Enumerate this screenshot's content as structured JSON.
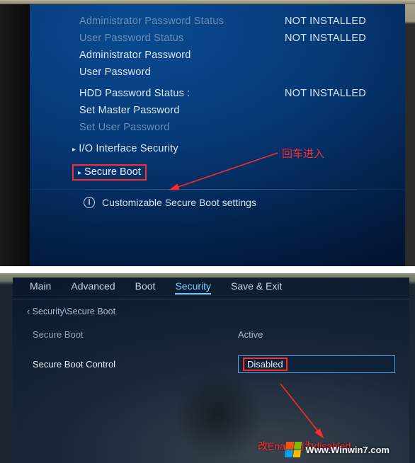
{
  "top": {
    "rows": [
      {
        "label": "Administrator Password Status",
        "value": "NOT INSTALLED",
        "dim": true
      },
      {
        "label": "User Password Status",
        "value": "NOT INSTALLED",
        "dim": true
      },
      {
        "label": "Administrator Password",
        "value": "",
        "dim": false
      },
      {
        "label": "User Password",
        "value": "",
        "dim": false
      },
      {
        "label": "HDD Password Status :",
        "value": "NOT INSTALLED",
        "dim": false
      },
      {
        "label": "Set Master Password",
        "value": "",
        "dim": false
      },
      {
        "label": "Set User Password",
        "value": "",
        "dim": true
      }
    ],
    "io_security": "I/O Interface Security",
    "secure_boot": "Secure Boot",
    "footer": "Customizable Secure Boot settings",
    "annotation": "回车进入"
  },
  "bottom": {
    "tabs": [
      "Main",
      "Advanced",
      "Boot",
      "Security",
      "Save & Exit"
    ],
    "active_tab_index": 3,
    "breadcrumb": "Security\\Secure Boot",
    "rows": [
      {
        "label": "Secure Boot",
        "value": "Active"
      }
    ],
    "sbc_label": "Secure Boot Control",
    "sbc_value": "Disabled",
    "annotation": "改Enabled为disabled",
    "watermark_text": "Www.Winwin7.com"
  }
}
